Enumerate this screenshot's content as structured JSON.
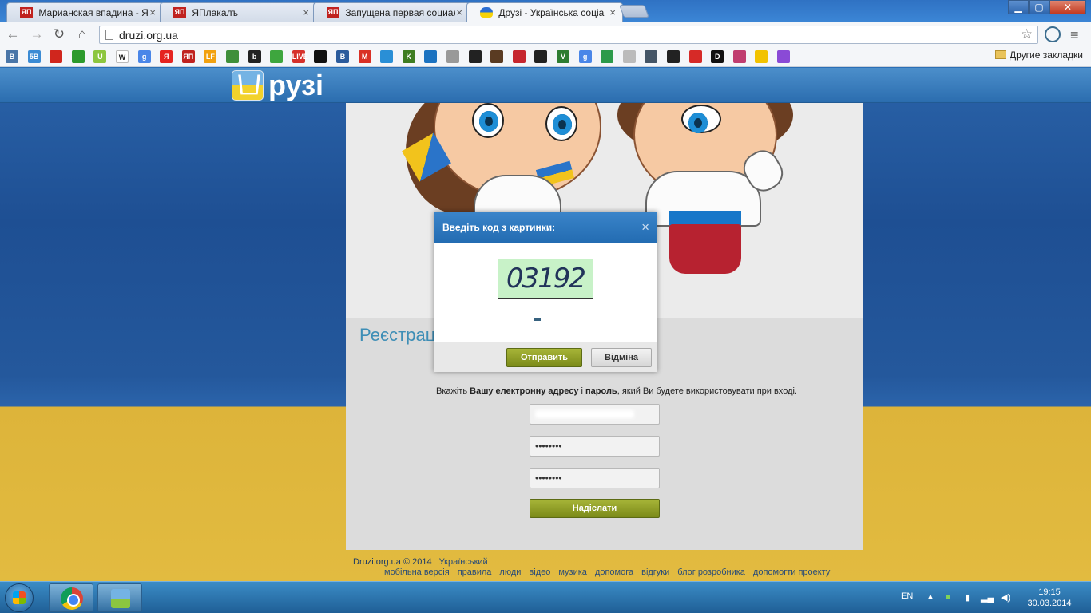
{
  "browser": {
    "tabs": [
      {
        "favicon": "ЯП",
        "title": "Марианская впадина - ЯП"
      },
      {
        "favicon": "ЯП",
        "title": "ЯПлакалъ"
      },
      {
        "favicon": "ЯП",
        "title": "Запущена первая социал"
      },
      {
        "favicon": "ua-heart",
        "title": "Друзі - Українська соціа"
      }
    ],
    "tab_close": "×",
    "url": "druzi.org.ua",
    "bookmarks_folder": "Другие закладки"
  },
  "bookmarks": [
    {
      "label": "В",
      "color": "#4a76a8"
    },
    {
      "label": "5В",
      "color": "#3b8bd4"
    },
    {
      "label": "",
      "color": "#d0261d"
    },
    {
      "label": "",
      "color": "#2d9a2d"
    },
    {
      "label": "U",
      "color": "#8dc63f"
    },
    {
      "label": "W",
      "color": "#ffffff"
    },
    {
      "label": "g",
      "color": "#4a86e8"
    },
    {
      "label": "Я",
      "color": "#e52420"
    },
    {
      "label": "ЯП",
      "color": "#c0221f"
    },
    {
      "label": "LF",
      "color": "#f2a10f"
    },
    {
      "label": "",
      "color": "#3f8f3a"
    },
    {
      "label": "b",
      "color": "#222222"
    },
    {
      "label": "",
      "color": "#3ea63e"
    },
    {
      "label": "LIVE",
      "color": "#d6302a"
    },
    {
      "label": "",
      "color": "#111111"
    },
    {
      "label": "B",
      "color": "#2b5b9c"
    },
    {
      "label": "M",
      "color": "#d93025"
    },
    {
      "label": "",
      "color": "#2a8fd6"
    },
    {
      "label": "K",
      "color": "#3f7d22"
    },
    {
      "label": "",
      "color": "#1b72c0"
    },
    {
      "label": "",
      "color": "#999999"
    },
    {
      "label": "",
      "color": "#222222"
    },
    {
      "label": "",
      "color": "#5a3b22"
    },
    {
      "label": "",
      "color": "#c6262e"
    },
    {
      "label": "",
      "color": "#222222"
    },
    {
      "label": "V",
      "color": "#2e7d32"
    },
    {
      "label": "g",
      "color": "#4a86e8"
    },
    {
      "label": "",
      "color": "#2c9a4a"
    },
    {
      "label": "",
      "color": "#bbbbbb"
    },
    {
      "label": "",
      "color": "#445566"
    },
    {
      "label": "",
      "color": "#222222"
    },
    {
      "label": "",
      "color": "#d62a27"
    },
    {
      "label": "D",
      "color": "#111111"
    },
    {
      "label": "",
      "color": "#c03d70"
    },
    {
      "label": "",
      "color": "#f2c200"
    },
    {
      "label": "",
      "color": "#8a4ad6"
    }
  ],
  "site": {
    "logo_text": "рузі",
    "registration_title": "Реєстрація",
    "hint_prefix": "Вкажіть ",
    "hint_bold1": "Вашу електронну адресу",
    "hint_mid": " і ",
    "hint_bold2": "пароль",
    "hint_suffix": ", який Ви будете використовувати при вході.",
    "password_value": "••••••••",
    "password_confirm_value": "••••••••",
    "submit_label": "Надіслати"
  },
  "modal": {
    "title": "Введіть код з картинки:",
    "close": "×",
    "captcha_text": "03192",
    "send_label": "Отправить",
    "cancel_label": "Відміна"
  },
  "footer": {
    "copyright": "Druzi.org.ua © 2014",
    "language": "Український",
    "links": [
      "мобільна версія",
      "правила",
      "люди",
      "відео",
      "музика",
      "допомога",
      "відгуки",
      "блог розробника",
      "допомогти проекту"
    ]
  },
  "taskbar": {
    "lang": "EN",
    "time": "19:15",
    "date": "30.03.2014"
  },
  "colors": {
    "header_blue": "#2b6daf",
    "button_olive": "#8d9b22",
    "flag_blue": "#24589c",
    "flag_yellow": "#e2bb40"
  }
}
